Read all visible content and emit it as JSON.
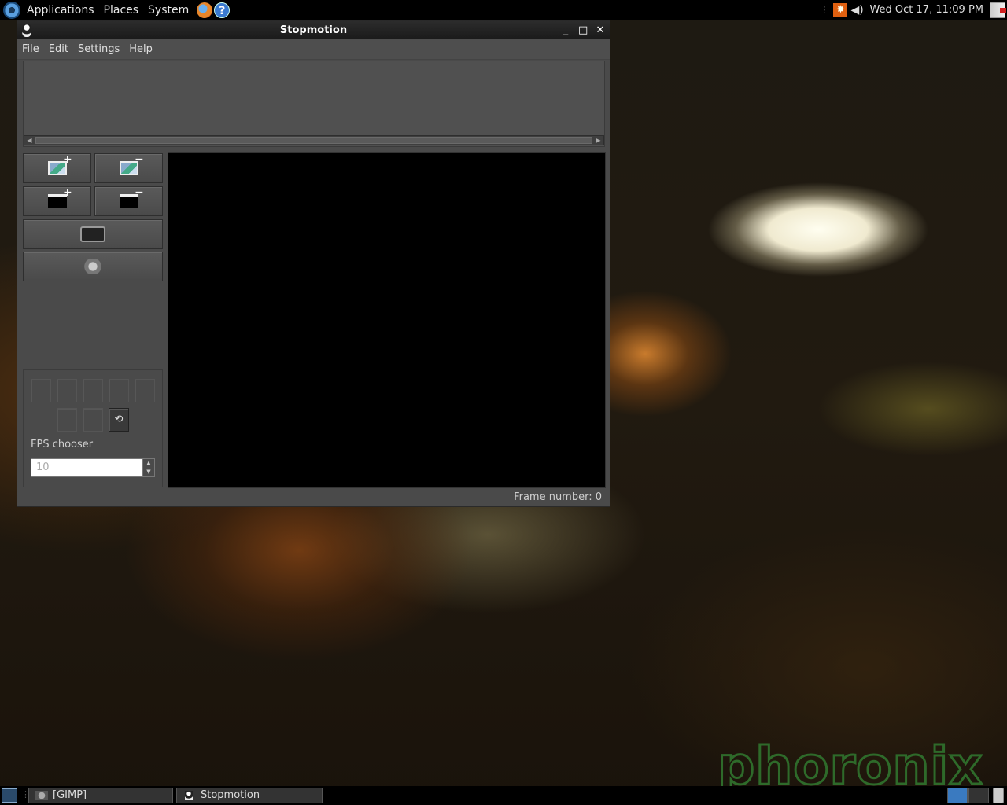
{
  "top_panel": {
    "menus": [
      "Applications",
      "Places",
      "System"
    ],
    "launchers": [
      {
        "icon": "os-logo-icon"
      },
      {
        "icon": "firefox-icon"
      },
      {
        "icon": "help-icon",
        "glyph": "?"
      }
    ],
    "clock": "Wed Oct 17, 11:09 PM"
  },
  "window": {
    "title": "Stopmotion",
    "controls": {
      "minimize": "_",
      "maximize": "□",
      "close": "✕"
    },
    "menubar": [
      "File",
      "Edit",
      "Settings",
      "Help"
    ],
    "tool_buttons": {
      "add_frames": "+",
      "remove_frames": "−",
      "add_scene": "+",
      "remove_scene": "−"
    },
    "fps_label": "FPS chooser",
    "fps_value": "10",
    "status": "Frame number: 0"
  },
  "watermark": "phoronix",
  "taskbar": {
    "tasks": [
      "[GIMP]",
      "Stopmotion"
    ]
  },
  "colors": {
    "panel_bg": "#000000",
    "window_bg": "#4a4a4a",
    "preview_bg": "#000000",
    "watermark": "#2e6a2a"
  }
}
